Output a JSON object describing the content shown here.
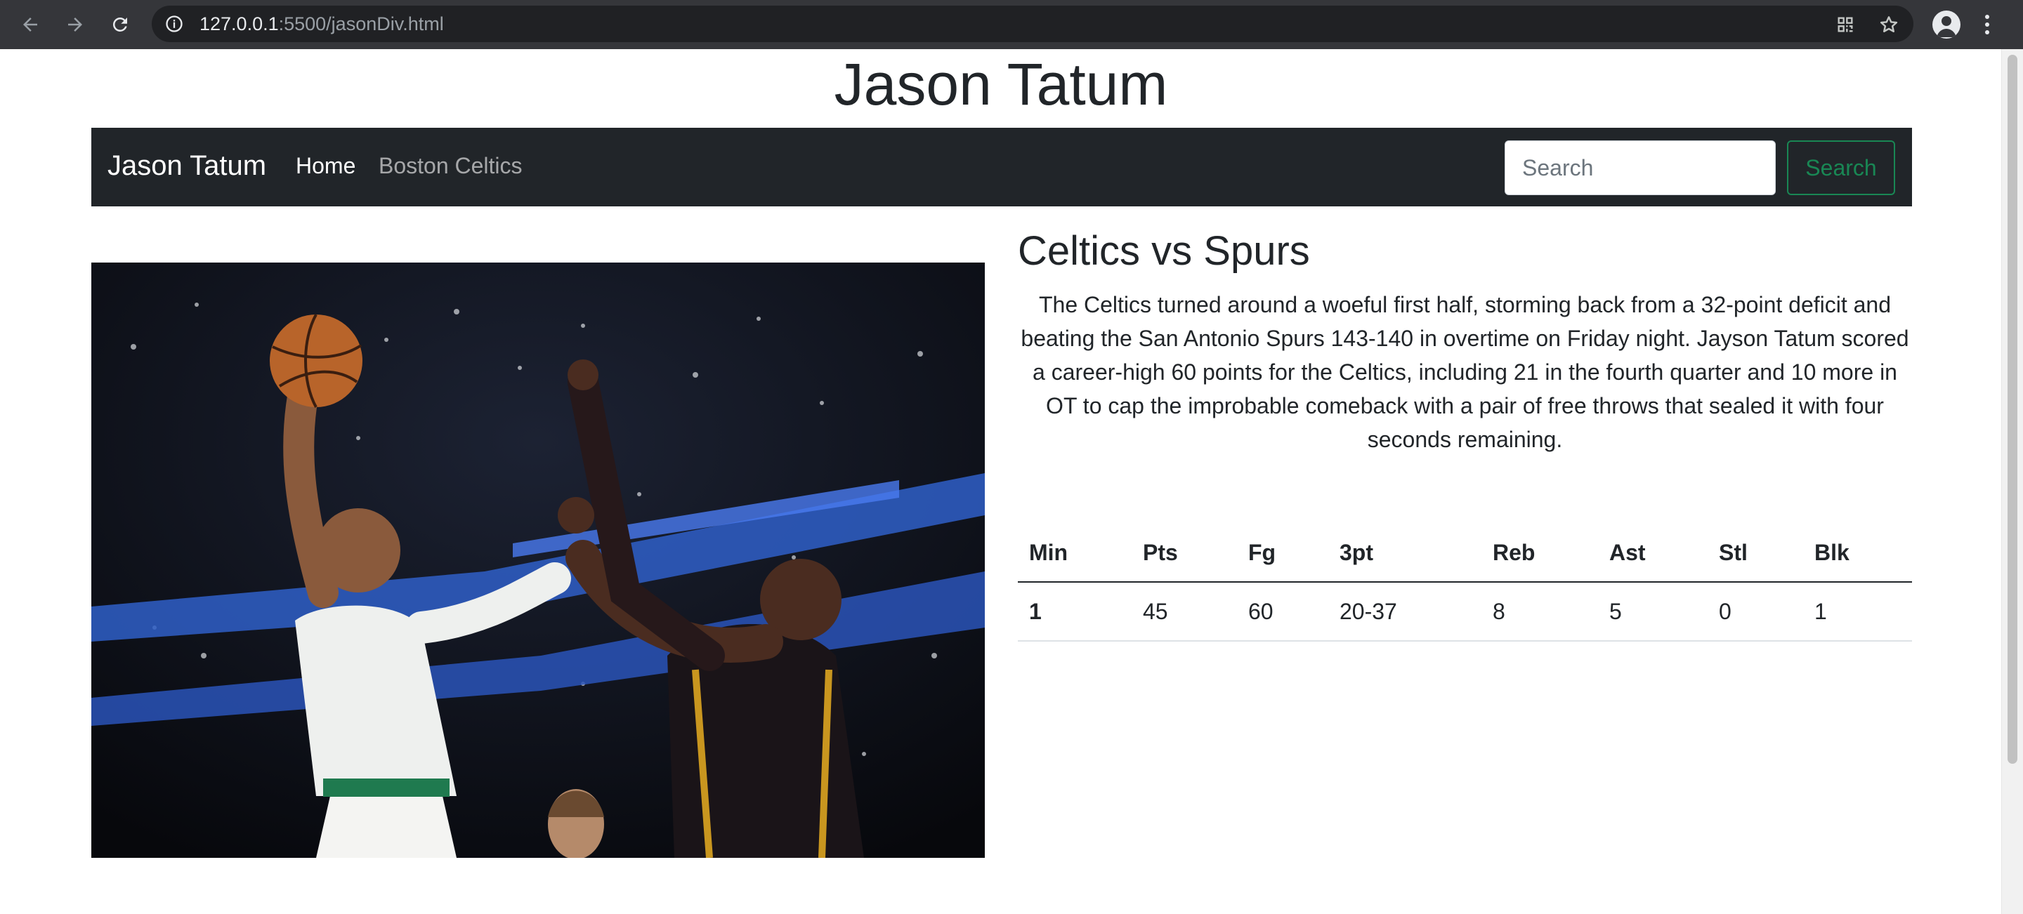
{
  "browser": {
    "url_host": "127.0.0.1",
    "url_rest": ":5500/jasonDiv.html"
  },
  "page": {
    "title": "Jason Tatum"
  },
  "navbar": {
    "brand": "Jason Tatum",
    "links": [
      "Home",
      "Boston Celtics"
    ],
    "search_placeholder": "Search",
    "search_button": "Search"
  },
  "article": {
    "heading": "Celtics vs Spurs",
    "body": "The Celtics turned around a woeful first half, storming back from a 32-point deficit and beating the San Antonio Spurs 143-140 in overtime on Friday night. Jayson Tatum scored a career-high 60 points for the Celtics, including 21 in the fourth quarter and 10 more in OT to cap the improbable comeback with a pair of free throws that sealed it with four seconds remaining."
  },
  "stats": {
    "headers": [
      "Min",
      "Pts",
      "Fg",
      "3pt",
      "Reb",
      "Ast",
      "Stl",
      "Blk"
    ],
    "rows": [
      [
        "1",
        "45",
        "60",
        "20-37",
        "8",
        "5",
        "0",
        "1"
      ]
    ]
  },
  "colors": {
    "navbar_bg": "#212529",
    "search_button": "#198754",
    "chrome_bg": "#35363a"
  },
  "icons": [
    "back-arrow-icon",
    "forward-arrow-icon",
    "reload-icon",
    "info-icon",
    "qr-code-icon",
    "star-icon",
    "profile-icon",
    "kebab-menu-icon"
  ]
}
